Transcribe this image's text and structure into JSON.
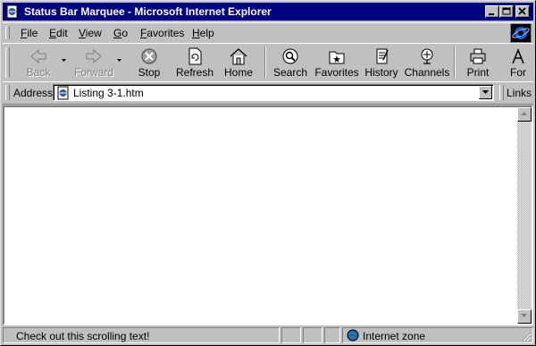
{
  "window": {
    "title": "Status Bar Marquee - Microsoft Internet Explorer"
  },
  "menubar": {
    "items": [
      {
        "accel": "F",
        "rest": "ile"
      },
      {
        "accel": "E",
        "rest": "dit"
      },
      {
        "accel": "V",
        "rest": "iew"
      },
      {
        "accel": "G",
        "rest": "o"
      },
      {
        "accel": "F",
        "rest": "avorites",
        "pre": ""
      },
      {
        "accel": "H",
        "rest": "elp"
      }
    ]
  },
  "toolbar": {
    "buttons": [
      {
        "label": "Back",
        "icon": "back-arrow-icon",
        "enabled": false
      },
      {
        "label": "Forward",
        "icon": "forward-arrow-icon",
        "enabled": false
      },
      {
        "label": "Stop",
        "icon": "stop-icon",
        "enabled": true
      },
      {
        "label": "Refresh",
        "icon": "refresh-icon",
        "enabled": true
      },
      {
        "label": "Home",
        "icon": "home-icon",
        "enabled": true
      },
      {
        "label": "Search",
        "icon": "search-icon",
        "enabled": true
      },
      {
        "label": "Favorites",
        "icon": "favorites-icon",
        "enabled": true
      },
      {
        "label": "History",
        "icon": "history-icon",
        "enabled": true
      },
      {
        "label": "Channels",
        "icon": "channels-icon",
        "enabled": true
      },
      {
        "label": "Print",
        "icon": "print-icon",
        "enabled": true
      },
      {
        "label": "For",
        "icon": "font-icon",
        "enabled": true
      }
    ]
  },
  "address": {
    "label": "Address",
    "value": "Listing 3-1.htm",
    "links_label": "Links"
  },
  "status": {
    "text": "Check out this scrolling text!",
    "zone": "Internet zone"
  },
  "colors": {
    "title_bar": "#000080",
    "face": "#c0c0c0",
    "content_bg": "#ffffff"
  }
}
